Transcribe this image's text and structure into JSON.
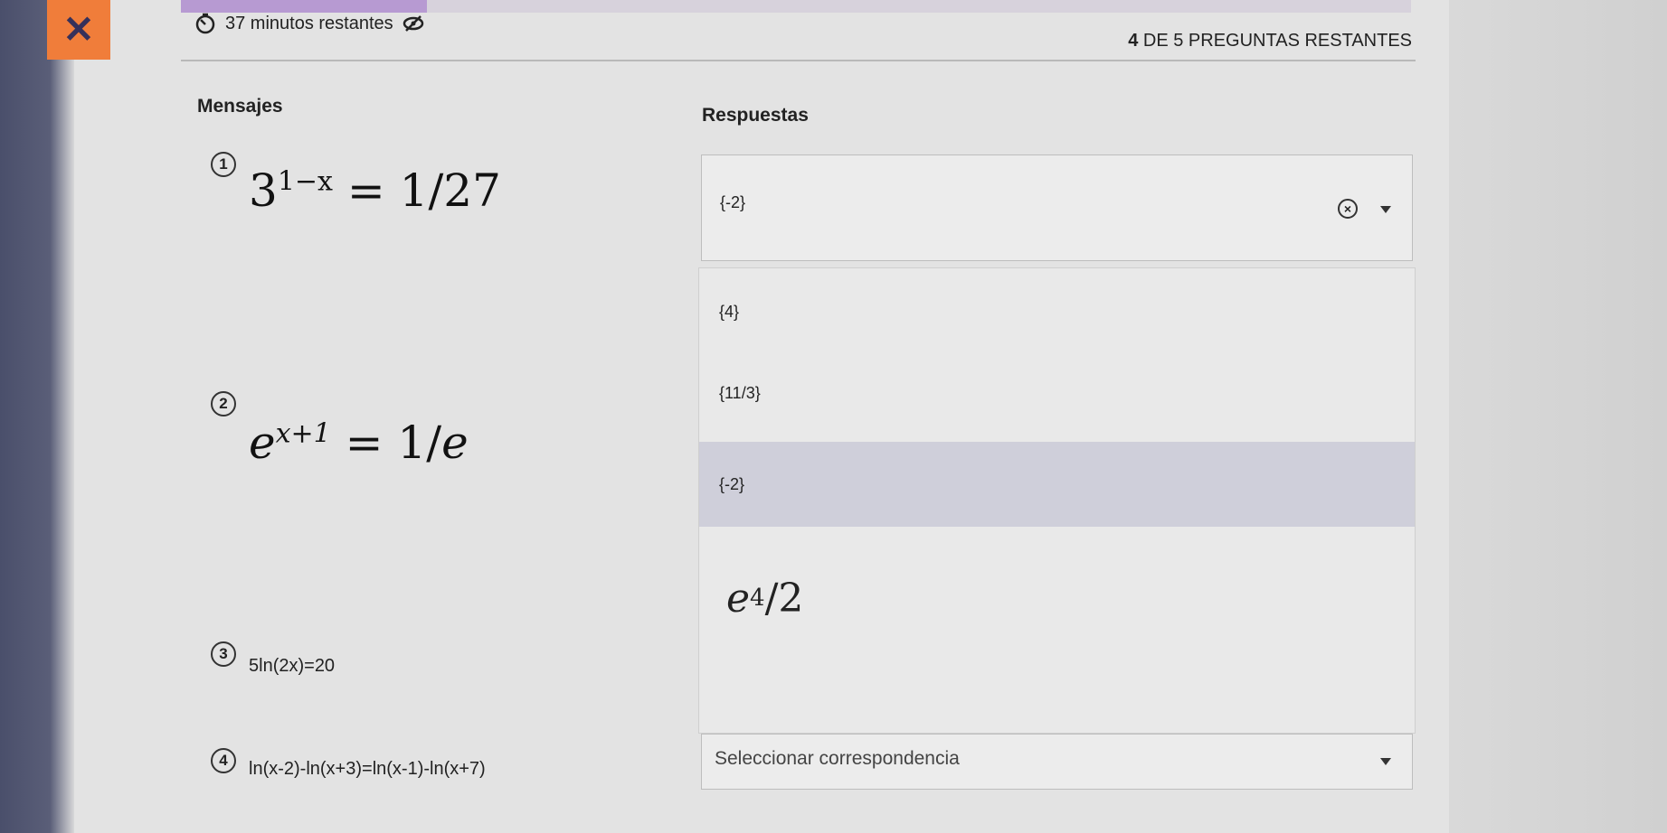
{
  "header": {
    "close_label": "✕",
    "timer_text": "37 minutos restantes",
    "remaining_count": "4",
    "remaining_text": "DE 5 PREGUNTAS RESTANTES",
    "progress_fraction": 0.2
  },
  "columns": {
    "left_title": "Mensajes",
    "right_title": "Respuestas"
  },
  "questions": [
    {
      "number": "1",
      "formula": "3^(1−x) = 1/27"
    },
    {
      "number": "2",
      "formula": "e^(x+1) = 1/e"
    },
    {
      "number": "3",
      "formula": "5ln(2x)=20"
    },
    {
      "number": "4",
      "formula": "ln(x-2)-ln(x+3)=ln(x-1)-ln(x+7)"
    }
  ],
  "answer1": {
    "selected_value": "{-2}",
    "clear_icon": "x-circle-icon",
    "caret_icon": "caret-down-icon"
  },
  "dropdown": {
    "options": [
      "{4}",
      "{11/3}",
      "{-2}",
      "e4/2"
    ],
    "highlighted_index": 2
  },
  "answer4": {
    "placeholder": "Seleccionar correspondencia"
  },
  "colors": {
    "accent_orange": "#f07d3a",
    "progress_purple": "#b79ad2",
    "highlight": "#cfcfda"
  }
}
